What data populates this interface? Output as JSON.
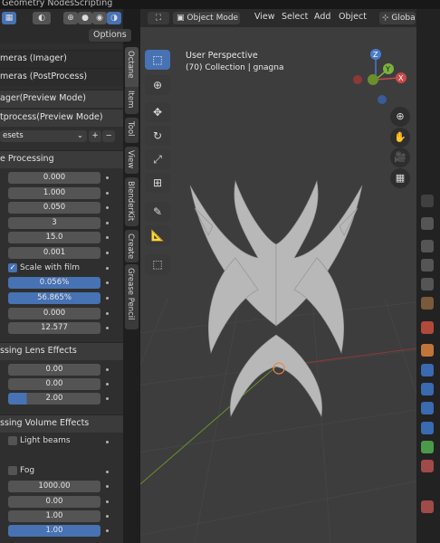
{
  "topbar": {
    "tab_geometry": "Geometry Nodes",
    "tab_scripting": "Scripting"
  },
  "left": {
    "options_label": "Options",
    "sections": [
      {
        "label": "meras (Imager)"
      },
      {
        "label": "meras (PostProcess)"
      },
      {
        "label": "ager(Preview Mode)"
      },
      {
        "label": "tprocess(Preview Mode)"
      }
    ],
    "presets_label": "esets",
    "add_label": "+",
    "remove_label": "−",
    "processing_header": "e Processing",
    "processing_values": [
      "0.000",
      "1.000",
      "0.050",
      "3",
      "15.0",
      "0.001"
    ],
    "scale_with_film": "Scale with film",
    "percent1": "0.056%",
    "percent2": "56.865%",
    "values_after": [
      "0.000",
      "12.577"
    ],
    "lens_header": "ssing Lens Effects",
    "lens_values": [
      "0.00",
      "0.00",
      "2.00"
    ],
    "lens_fill": 0.2,
    "volume_header": "ssing Volume Effects",
    "light_beams": "Light beams",
    "fog": "Fog",
    "volume_values": [
      "1000.00",
      "0.00",
      "1.00",
      "1.00"
    ]
  },
  "vtabs": [
    "Octane",
    "Item",
    "Tool",
    "View",
    "BlenderKit",
    "Create",
    "Grease Pencil"
  ],
  "viewport": {
    "mode": "Object Mode",
    "menus": [
      "View",
      "Select",
      "Add",
      "Object"
    ],
    "global": "Globa",
    "title": "User Perspective",
    "subtitle": "(70) Collection | gnagna",
    "gizmo": {
      "x": "X",
      "y": "Y",
      "z": "Z"
    }
  },
  "colors": {
    "accent": "#4772b3",
    "panel": "#2f2f2f",
    "viewport": "#3d3d3d"
  }
}
